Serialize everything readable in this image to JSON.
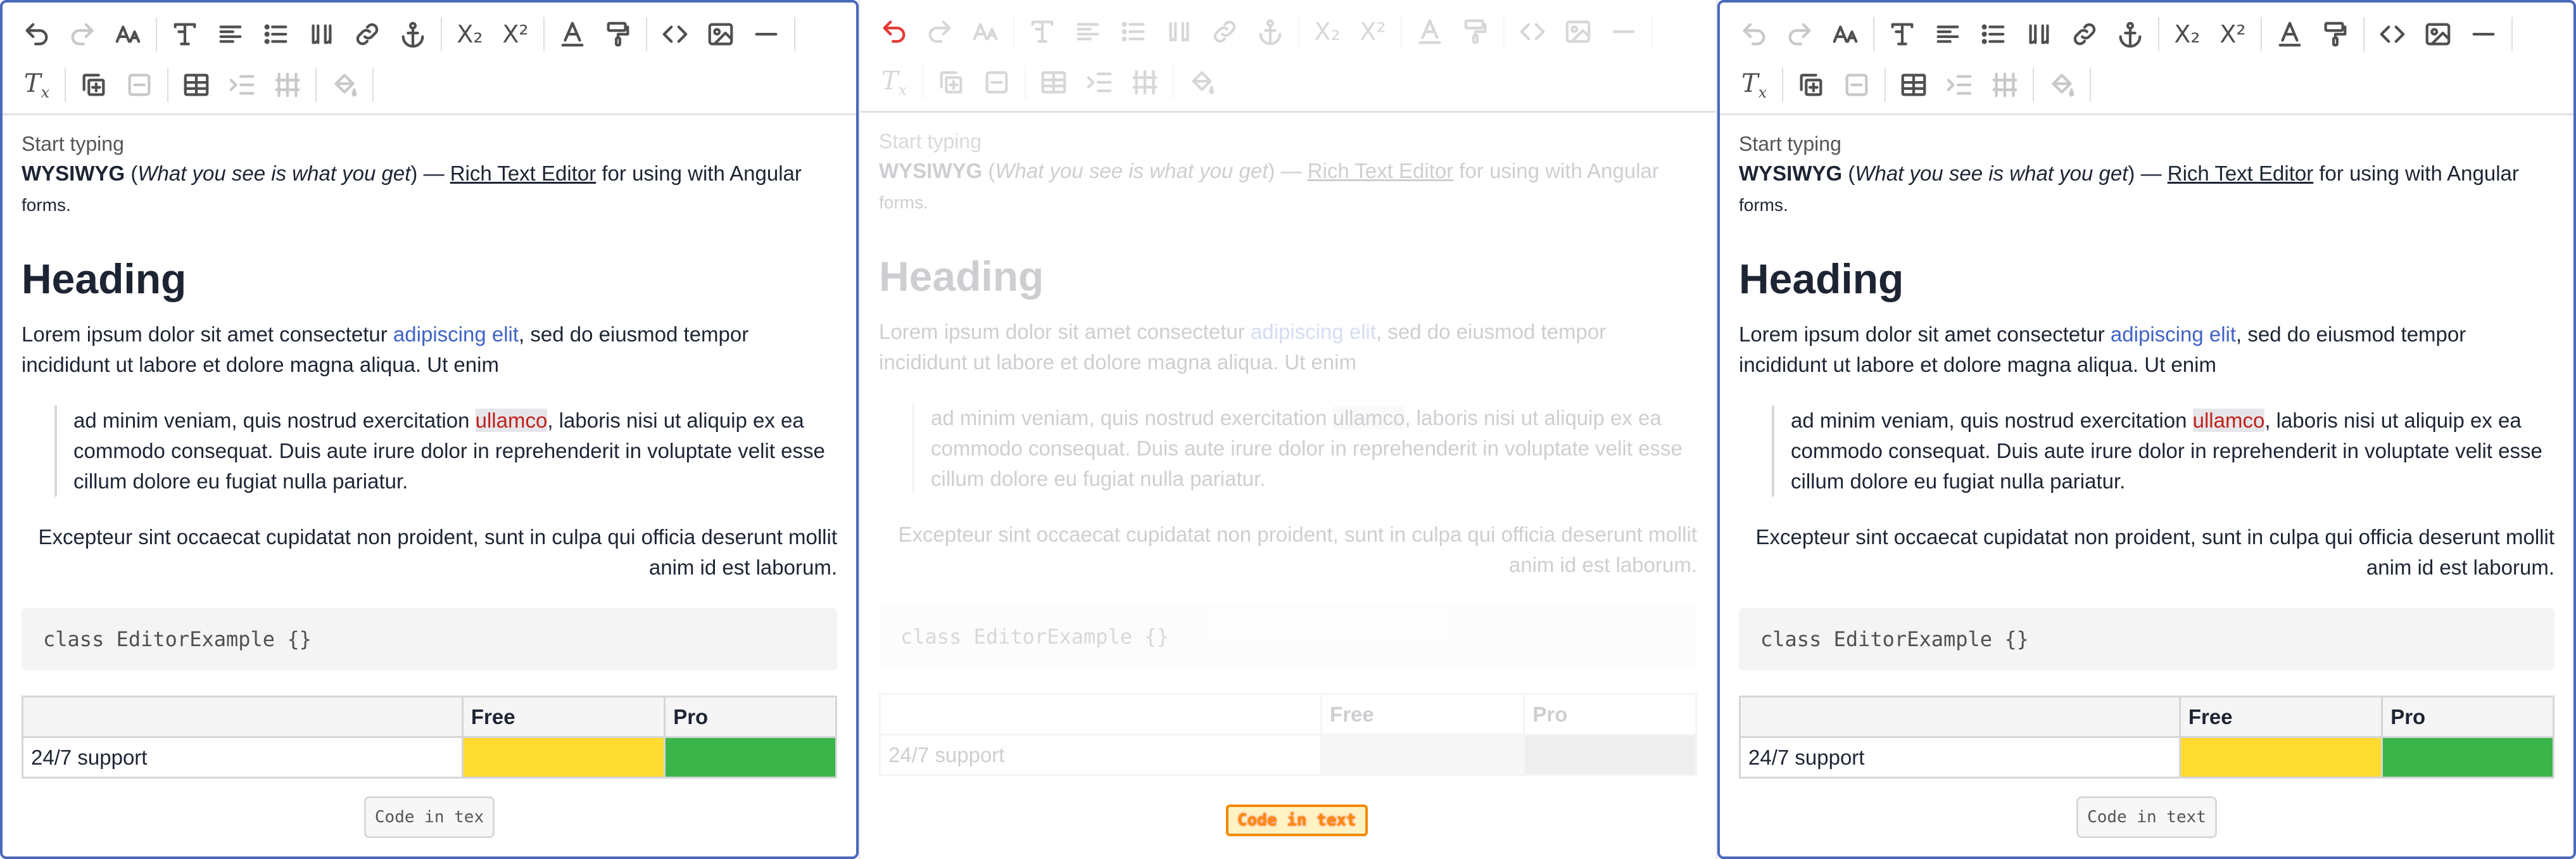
{
  "editors": {
    "left": {
      "placeholder": "Start typing",
      "intro": {
        "bold": "WYSIWYG",
        "open_paren": " (",
        "italic": "What you see is what you get",
        "close": ") — ",
        "link": "Rich Text Editor",
        "after": " for using with Angular",
        "small": "forms."
      },
      "heading": "Heading",
      "para1_a": "Lorem ipsum dolor sit amet consectetur ",
      "para1_link": "adipiscing elit",
      "para1_b": ", sed do eiusmod tempor incididunt ut labore et dolore magna aliqua. Ut enim",
      "quote_a": "ad minim veniam, quis nostrud exercitation ",
      "quote_mark": "ullamco",
      "quote_b": ", laboris nisi ut aliquip ex ea commodo consequat. Duis aute irure dolor in reprehenderit in voluptate velit esse cillum dolore eu fugiat nulla pariatur.",
      "right_para": "Excepteur sint occaecat cupidatat non proident, sunt in culpa qui officia deserunt mollit anim id est laborum.",
      "code": "class EditorExample {}",
      "table": {
        "headers": [
          "",
          "Free",
          "Pro"
        ],
        "row_label": "24/7 support"
      },
      "code_tag": "Code in tex"
    },
    "middle": {
      "placeholder": "Start typing",
      "intro": {
        "bold": "WYSIWYG",
        "open_paren": " (",
        "italic": "What you see is what you get",
        "close": ") — ",
        "link": "Rich Text Editor",
        "after": " for using with Angular",
        "small": "forms."
      },
      "heading": "Heading",
      "para1_a": "Lorem ipsum dolor sit amet consectetur ",
      "para1_link": "adipiscing elit",
      "para1_b": ", sed do eiusmod tempor incididunt ut labore et dolore magna aliqua. Ut enim",
      "quote_a": "ad minim veniam, quis nostrud exercitation ",
      "quote_mark": "ullamco",
      "quote_b": ", laboris nisi ut aliquip ex ea commodo consequat. Duis aute irure dolor in reprehenderit in voluptate velit esse cillum dolore eu fugiat nulla pariatur.",
      "right_para": "Excepteur sint occaecat cupidatat non proident, sunt in culpa qui officia deserunt mollit anim id est laborum.",
      "code": "class EditorExample {}",
      "table": {
        "headers": [
          "",
          "Free",
          "Pro"
        ],
        "row_label": "24/7 support"
      },
      "code_tag": "Code in text"
    },
    "right": {
      "placeholder": "Start typing",
      "intro": {
        "bold": "WYSIWYG",
        "open_paren": " (",
        "italic": "What you see is what you get",
        "close": ") — ",
        "link": "Rich Text Editor",
        "after": " for using with Angular",
        "small": "forms."
      },
      "heading": "Heading",
      "para1_a": "Lorem ipsum dolor sit amet consectetur ",
      "para1_link": "adipiscing elit",
      "para1_b": ", sed do eiusmod tempor incididunt ut labore et dolore magna aliqua. Ut enim",
      "quote_a": "ad minim veniam, quis nostrud exercitation ",
      "quote_mark": "ullamco",
      "quote_b": ", laboris nisi ut aliquip ex ea commodo consequat. Duis aute irure dolor in reprehenderit in voluptate velit esse cillum dolore eu fugiat nulla pariatur.",
      "right_para": "Excepteur sint occaecat cupidatat non proident, sunt in culpa qui officia deserunt mollit anim id est laborum.",
      "code": "class EditorExample {}",
      "table": {
        "headers": [
          "",
          "Free",
          "Pro"
        ],
        "row_label": "24/7 support"
      },
      "code_tag": "Code in text"
    }
  },
  "toolbar_icons": {
    "row1": [
      "undo-icon",
      "redo-icon",
      "font-size-icon",
      "text-style-icon",
      "align-icon",
      "list-icon",
      "quote-icon",
      "link-icon",
      "anchor-icon",
      "subscript-icon",
      "superscript-icon",
      "text-color-icon",
      "paint-roller-icon",
      "code-icon",
      "image-icon",
      "horizontal-rule-icon"
    ],
    "row2": [
      "clear-format-icon",
      "add-cell-icon",
      "remove-cell-icon",
      "table-icon",
      "indent-icon",
      "table-columns-icon",
      "background-fill-icon"
    ]
  },
  "colors": {
    "focus_border": "#4a69bd",
    "link": "#3f63c6",
    "mark_text": "#c0221b",
    "yellow_cell": "#fddb31",
    "green_cell": "#3bb54a",
    "undo_active": "#e53935"
  }
}
